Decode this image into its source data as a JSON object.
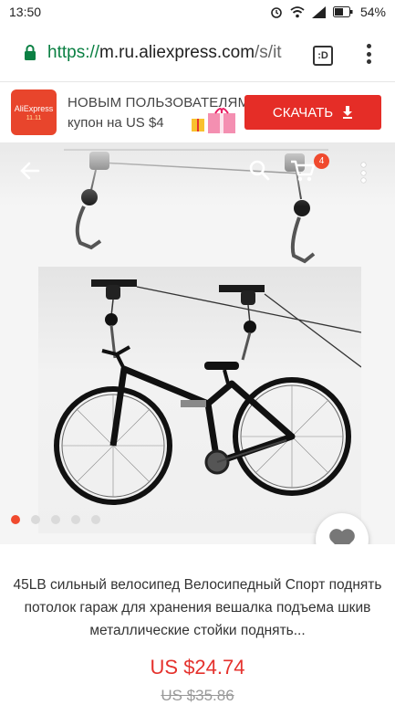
{
  "status_bar": {
    "time": "13:50",
    "battery": "54%",
    "icons": [
      "alarm-icon",
      "wifi-icon",
      "signal-icon",
      "battery-icon"
    ]
  },
  "browser": {
    "url_scheme": "https://",
    "url_host": "m.ru.aliexpress.com",
    "url_path": "/s/it",
    "tabs_label": ":D"
  },
  "promo": {
    "logo_text": "AliExpress",
    "logo_sub": "11.11",
    "line1": "НОВЫМ ПОЛЬЗОВАТЕЛЯМ",
    "line2": "купон на US $4",
    "button_label": "СКАЧАТЬ"
  },
  "product_nav": {
    "cart_count": "4"
  },
  "gallery": {
    "dot_count": 5,
    "active_index": 0
  },
  "product": {
    "title": "45LB сильный велосипед Велосипедный Спорт поднять потолок гараж для хранения вешалка подъема шкив металлические стойки поднять...",
    "price": "US $24.74",
    "old_price": "US $35.86"
  },
  "colors": {
    "accent": "#e52d27",
    "url_scheme": "#0b8043"
  }
}
